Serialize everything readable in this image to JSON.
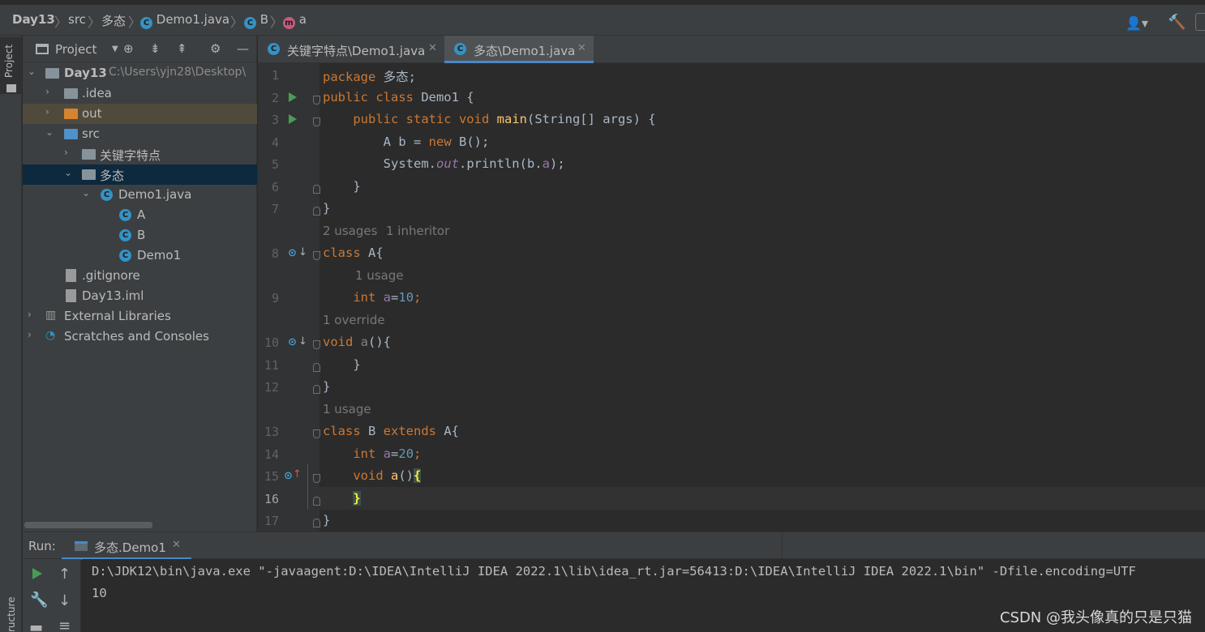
{
  "breadcrumb": {
    "project": "Day13",
    "src": "src",
    "package": "多态",
    "file": "Demo1.java",
    "class": "B",
    "member": "a"
  },
  "project_panel": {
    "title": "Project",
    "root": "Day13",
    "root_path": "C:\\Users\\yjn28\\Desktop\\",
    "items": [
      {
        "label": "Day13"
      },
      {
        "label": ".idea"
      },
      {
        "label": "out"
      },
      {
        "label": "src"
      },
      {
        "label": "关键字特点"
      },
      {
        "label": "多态"
      },
      {
        "label": "Demo1.java"
      },
      {
        "label": "A"
      },
      {
        "label": "B"
      },
      {
        "label": "Demo1"
      },
      {
        "label": ".gitignore"
      },
      {
        "label": "Day13.iml"
      },
      {
        "label": "External Libraries"
      },
      {
        "label": "Scratches and Consoles"
      }
    ]
  },
  "tabs": [
    {
      "label": "关键字特点\\Demo1.java",
      "active": false
    },
    {
      "label": "多态\\Demo1.java",
      "active": true
    }
  ],
  "editor": {
    "lines": [
      "1",
      "2",
      "3",
      "4",
      "5",
      "6",
      "7",
      "8",
      "9",
      "10",
      "11",
      "12",
      "13",
      "14",
      "15",
      "16",
      "17"
    ],
    "hints": {
      "a_usages": "2 usages",
      "a_inheritor": "1 inheritor",
      "field_usage": "1 usage",
      "override": "1 override",
      "b_usage": "1 usage"
    },
    "code": {
      "l1_kw": "package",
      "l1_rest": " 多态;",
      "l2_kw": "public class",
      "l2_rest": " Demo1 {",
      "l3_kw": "public static void",
      "l3_fn": "main",
      "l3_rest": "(String[] args) {",
      "l4_a": "A b = ",
      "l4_kw": "new",
      "l4_b": " B();",
      "l5_a": "System.",
      "l5_out": "out",
      "l5_b": ".println(b.",
      "l5_fld": "a",
      "l5_c": ");",
      "l6": "}",
      "l7": "}",
      "l8_kw": "class",
      "l8_rest": " A{",
      "l9_kw": "int",
      "l9_fld": "a",
      "l9_eq": "=",
      "l9_num": "10",
      "l9_end": ";",
      "l10_kw": "void",
      "l10_name": "a",
      "l10_rest": "(){",
      "l11": "}",
      "l12": "}",
      "l13_kw": "class",
      "l13_b": " B ",
      "l13_kw2": "extends",
      "l13_rest": " A{",
      "l14_kw": "int",
      "l14_fld": "a",
      "l14_eq": "=",
      "l14_num": "20",
      "l14_end": ";",
      "l15_kw": "void",
      "l15_fn": "a",
      "l15_rest": "()",
      "l15_brace": "{",
      "l16_brace": "}",
      "l17": "}"
    }
  },
  "run": {
    "label": "Run:",
    "tab": "多态.Demo1",
    "output": [
      "D:\\JDK12\\bin\\java.exe \"-javaagent:D:\\IDEA\\IntelliJ IDEA 2022.1\\lib\\idea_rt.jar=56413:D:\\IDEA\\IntelliJ IDEA 2022.1\\bin\" -Dfile.encoding=UTF",
      "10"
    ]
  },
  "sidebar": {
    "project_tab": "Project",
    "structure_tab": "ructure"
  },
  "watermark": "CSDN @我头像真的只是只猫",
  "colors": {
    "keyword": "#cc7832",
    "function": "#ffc66d",
    "field": "#9876aa",
    "number": "#6897bb",
    "accent": "#4a88c7"
  }
}
